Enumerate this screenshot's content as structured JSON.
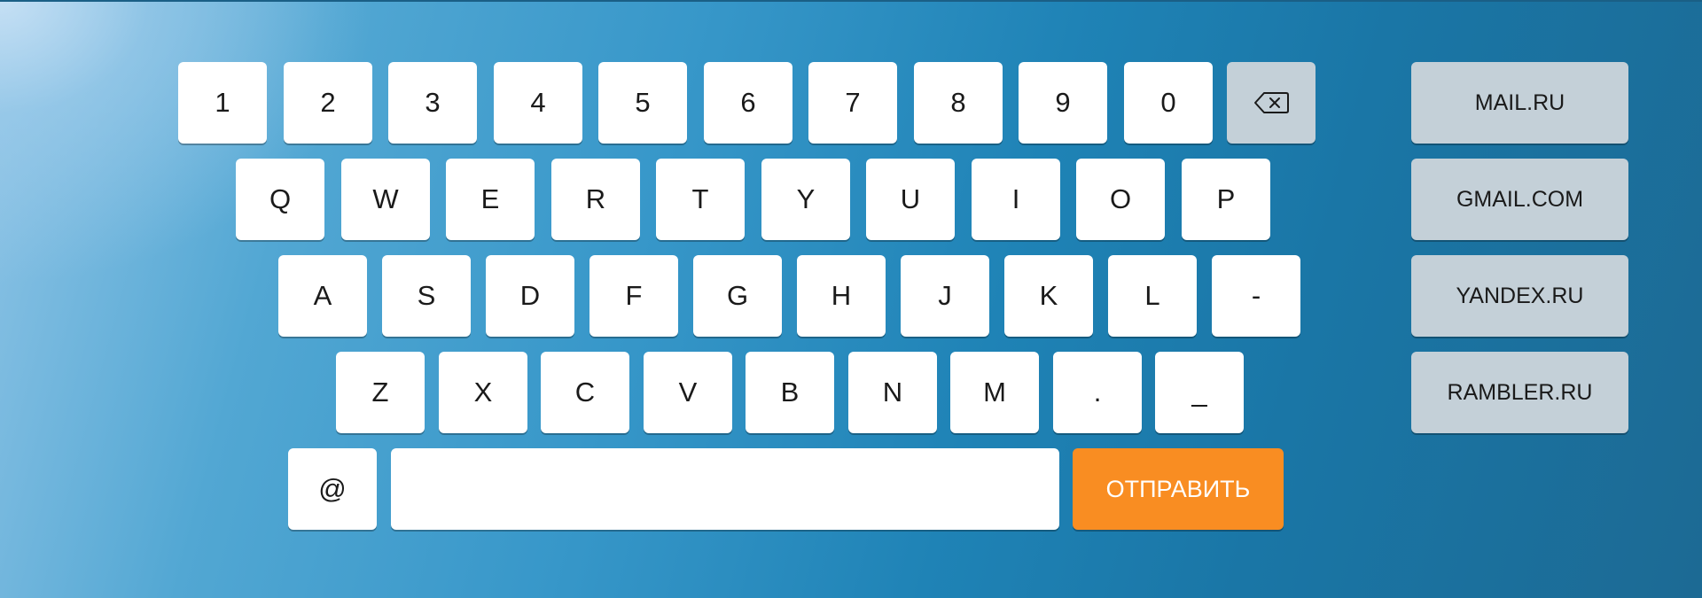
{
  "keyboard": {
    "rows": [
      [
        "1",
        "2",
        "3",
        "4",
        "5",
        "6",
        "7",
        "8",
        "9",
        "0"
      ],
      [
        "Q",
        "W",
        "E",
        "R",
        "T",
        "Y",
        "U",
        "I",
        "O",
        "P"
      ],
      [
        "A",
        "S",
        "D",
        "F",
        "G",
        "H",
        "J",
        "K",
        "L",
        "-"
      ],
      [
        "Z",
        "X",
        "C",
        "V",
        "B",
        "N",
        "M",
        ".",
        "_"
      ]
    ],
    "backspace_icon": "backspace-icon",
    "at_key": "@",
    "space_key_label": "",
    "send_label": "ОТПРАВИТЬ"
  },
  "domains": [
    "MAIL.RU",
    "GMAIL.COM",
    "YANDEX.RU",
    "RAMBLER.RU"
  ],
  "colors": {
    "send": "#f98d22",
    "special_key": "#c4d0d8",
    "key": "#ffffff",
    "background_dark": "#1c6a94",
    "background_light": "#8fc4e6"
  }
}
